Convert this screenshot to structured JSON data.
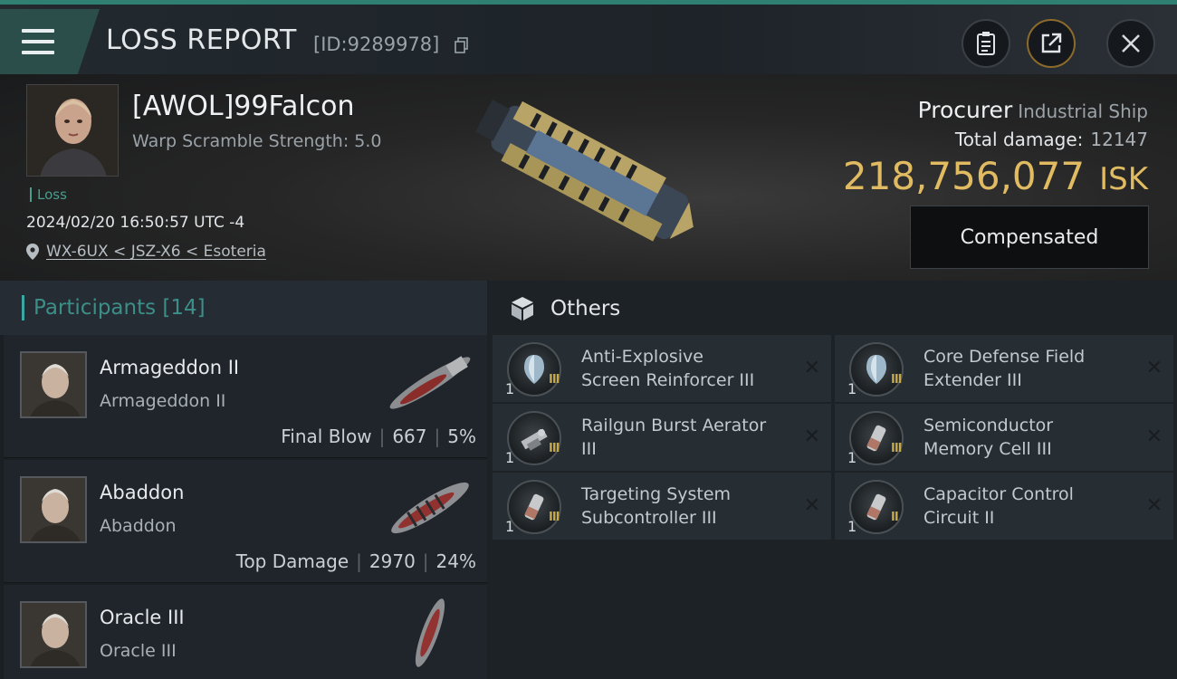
{
  "header": {
    "title": "LOSS REPORT",
    "report_id": "[ID:9289978]",
    "icons": [
      "menu-icon",
      "copy-icon",
      "clipboard-icon",
      "share-icon",
      "close-icon"
    ]
  },
  "victim": {
    "name": "[AWOL]99Falcon",
    "warp_scramble": "Warp Scramble Strength: 5.0",
    "tag": "Loss",
    "datetime": "2024/02/20 16:50:57 UTC -4",
    "location": "WX-6UX < JSZ-X6 < Esoteria",
    "ship": "Procurer",
    "ship_class": "Industrial Ship",
    "total_damage_label": "Total damage:",
    "total_damage": "12147",
    "isk_value": "218,756,077",
    "isk_unit": "ISK",
    "status_button": "Compensated"
  },
  "participants": {
    "label": "Participants",
    "count": "[14]",
    "rows": [
      {
        "name": "Armageddon II",
        "ship": "Armageddon II",
        "role": "Final Blow",
        "damage": "667",
        "percent": "5%"
      },
      {
        "name": "Abaddon",
        "ship": "Abaddon",
        "role": "Top Damage",
        "damage": "2970",
        "percent": "24%"
      },
      {
        "name": "Oracle III",
        "ship": "Oracle III"
      }
    ]
  },
  "others": {
    "label": "Others",
    "items": [
      {
        "name_line1": "Anti-Explosive",
        "name_line2": "Screen Reinforcer III",
        "qty": "1",
        "tier": "III"
      },
      {
        "name_line1": "Core Defense Field",
        "name_line2": "Extender III",
        "qty": "1",
        "tier": "III"
      },
      {
        "name_line1": "Railgun Burst Aerator",
        "name_line2": "III",
        "qty": "1",
        "tier": "III"
      },
      {
        "name_line1": "Semiconductor",
        "name_line2": "Memory Cell III",
        "qty": "1",
        "tier": "III"
      },
      {
        "name_line1": "Targeting System",
        "name_line2": "Subcontroller III",
        "qty": "1",
        "tier": "III"
      },
      {
        "name_line1": "Capacitor Control",
        "name_line2": "Circuit II",
        "qty": "1",
        "tier": "II"
      }
    ],
    "dismiss_glyph": "✕"
  },
  "colors": {
    "accent": "#3aa7a0",
    "isk_gold": "#e0bb62",
    "tier_gold": "#c7a94a"
  }
}
